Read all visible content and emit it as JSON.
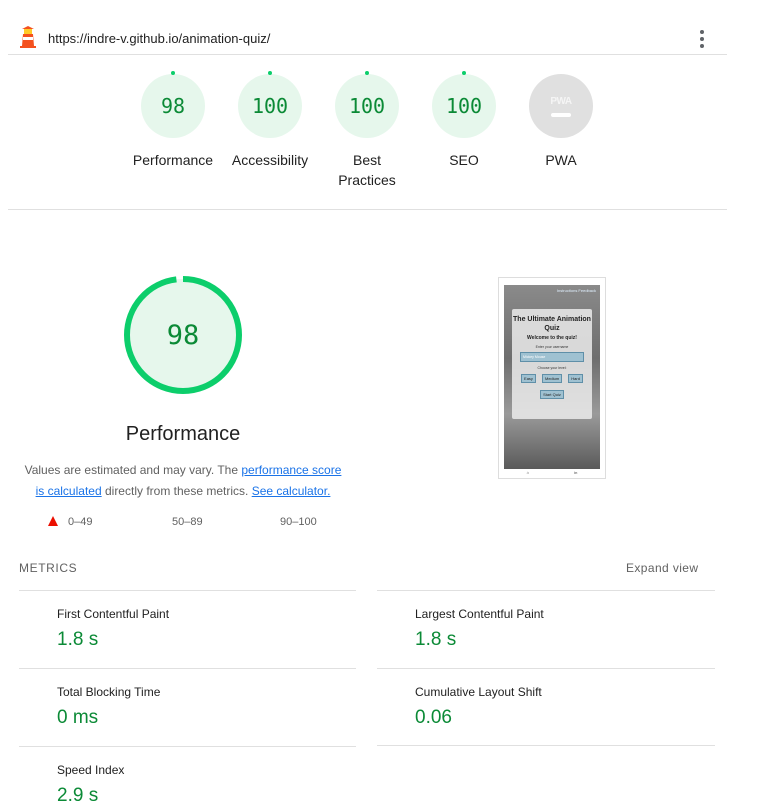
{
  "topbar": {
    "url": "https://indre-v.github.io/animation-quiz/",
    "logo_icon": "lighthouse-icon",
    "menu_icon": "more-vert-icon"
  },
  "colors": {
    "pass": "#0cce6b",
    "pass_text": "#0b8a36",
    "pass_bg": "#e6f7ec",
    "fail": "#eb0f00",
    "link": "#1a73e8"
  },
  "categories": [
    {
      "score": "98",
      "label": "Performance"
    },
    {
      "score": "100",
      "label": "Accessibility"
    },
    {
      "score": "100",
      "label": "Best Practices"
    },
    {
      "score": "100",
      "label": "SEO"
    },
    {
      "score": "",
      "label": "PWA",
      "badge": "PWA"
    }
  ],
  "performance": {
    "score": "98",
    "score_fraction": 0.98,
    "title": "Performance",
    "desc_prefix": "Values are estimated and may vary. The ",
    "desc_link1": "performance score is calculated",
    "desc_middle": " directly from these metrics. ",
    "desc_link2": "See calculator.",
    "legend": {
      "fail": "0–49",
      "average": "50–89",
      "pass": "90–100"
    }
  },
  "screenshot": {
    "nav": "Instructions   Feedback",
    "title": "The Ultimate Animation Quiz",
    "welcome": "Welcome to the quiz!",
    "enter_name": "Enter your username",
    "input_value": "Mickey Mouse",
    "choose_level": "Choose your level:",
    "easy": "Easy",
    "medium": "Medium",
    "hard": "Hard",
    "start": "Start Quiz",
    "footer_left": "⌂",
    "footer_right": "in"
  },
  "metrics": {
    "header": "METRICS",
    "expand": "Expand view",
    "items": [
      {
        "name": "First Contentful Paint",
        "value": "1.8 s"
      },
      {
        "name": "Largest Contentful Paint",
        "value": "1.8 s"
      },
      {
        "name": "Total Blocking Time",
        "value": "0 ms"
      },
      {
        "name": "Cumulative Layout Shift",
        "value": "0.06"
      },
      {
        "name": "Speed Index",
        "value": "2.9 s"
      }
    ]
  }
}
